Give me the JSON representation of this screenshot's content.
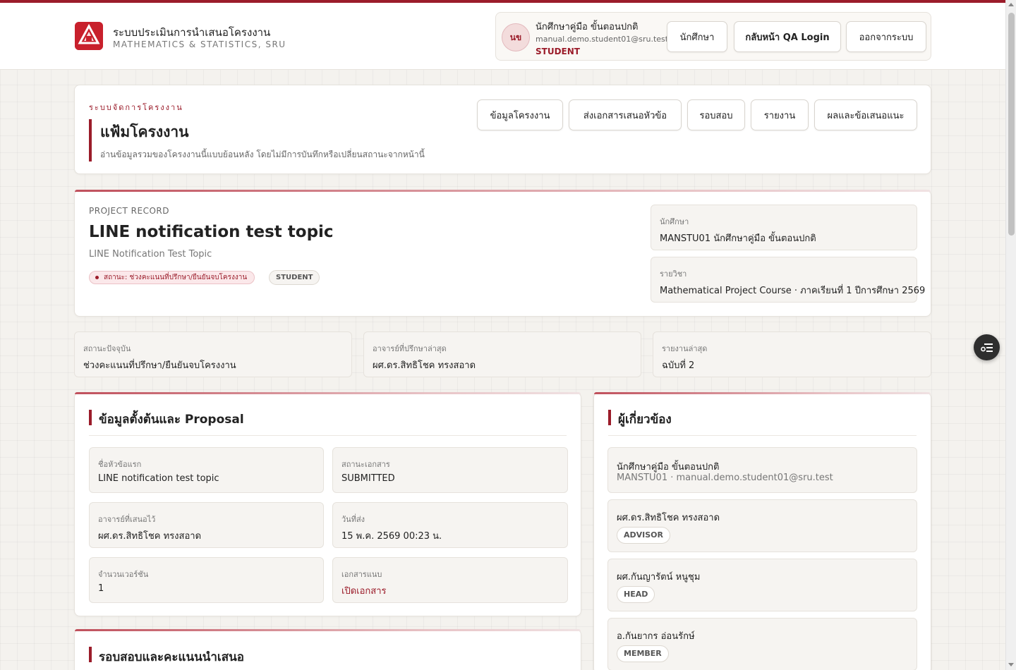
{
  "header": {
    "brand_title": "ระบบประเมินการนำเสนอโครงงาน",
    "brand_subtitle": "MATHEMATICS & STATISTICS, SRU",
    "user": {
      "initials": "นข",
      "name": "นักศึกษาคู่มือ ขั้นตอนปกติ",
      "email": "manual.demo.student01@sru.test",
      "role": "STUDENT"
    },
    "buttons": {
      "student": "นักศึกษา",
      "qa_login": "กลับหน้า QA Login",
      "logout": "ออกจากระบบ"
    }
  },
  "nav_card": {
    "kicker": "ระบบจัดการโครงงาน",
    "title": "แฟ้มโครงงาน",
    "description": "อ่านข้อมูลรวมของโครงงานนี้แบบย้อนหลัง โดยไม่มีการบันทึกหรือเปลี่ยนสถานะจากหน้านี้",
    "tabs": [
      "ข้อมูลโครงงาน",
      "ส่งเอกสารเสนอหัวข้อ",
      "รอบสอบ",
      "รายงาน",
      "ผลและข้อเสนอแนะ"
    ]
  },
  "record": {
    "label": "PROJECT RECORD",
    "title": "LINE notification test topic",
    "subtitle": "LINE Notification Test Topic",
    "status_pill": "สถานะ: ช่วงคะแนนที่ปรึกษา/ยืนยันจบโครงงาน",
    "role_pill": "STUDENT",
    "student": {
      "label": "นักศึกษา",
      "value": "MANSTU01 นักศึกษาคู่มือ ขั้นตอนปกติ"
    },
    "course": {
      "label": "รายวิชา",
      "value": "Mathematical Project Course · ภาคเรียนที่ 1 ปีการศึกษา 2569"
    }
  },
  "summary": [
    {
      "label": "สถานะปัจจุบัน",
      "value": "ช่วงคะแนนที่ปรึกษา/ยืนยันจบโครงงาน"
    },
    {
      "label": "อาจารย์ที่ปรึกษาล่าสุด",
      "value": "ผศ.ดร.สิทธิโชค ทรงสอาด"
    },
    {
      "label": "รายงานล่าสุด",
      "value": "ฉบับที่ 2"
    }
  ],
  "proposal": {
    "title": "ข้อมูลตั้งต้นและ Proposal",
    "fields": {
      "topic": {
        "label": "ชื่อหัวข้อแรก",
        "value": "LINE notification test topic"
      },
      "doc_status": {
        "label": "สถานะเอกสาร",
        "value": "SUBMITTED"
      },
      "advisor": {
        "label": "อาจารย์ที่เสนอไว้",
        "value": "ผศ.ดร.สิทธิโชค ทรงสอาด"
      },
      "submitted_at": {
        "label": "วันที่ส่ง",
        "value": "15 พ.ค. 2569 00:23 น."
      },
      "versions": {
        "label": "จำนวนเวอร์ชัน",
        "value": "1"
      },
      "attachment": {
        "label": "เอกสารแนบ",
        "value": "เปิดเอกสาร"
      }
    }
  },
  "people": {
    "title": "ผู้เกี่ยวข้อง",
    "student": {
      "name": "นักศึกษาคู่มือ ขั้นตอนปกติ",
      "meta": "MANSTU01 · manual.demo.student01@sru.test"
    },
    "members": [
      {
        "name": "ผศ.ดร.สิทธิโชค ทรงสอาด",
        "role": "ADVISOR"
      },
      {
        "name": "ผศ.กันญารัตน์ หนูชุม",
        "role": "HEAD"
      },
      {
        "name": "อ.กันยากร อ่อนรักษ์",
        "role": "MEMBER"
      }
    ]
  },
  "exam": {
    "title": "รอบสอบและคะแนนนำเสนอ"
  },
  "colors": {
    "accent": "#9b1c2a",
    "background": "#f4f2ee",
    "card": "#ffffff"
  }
}
